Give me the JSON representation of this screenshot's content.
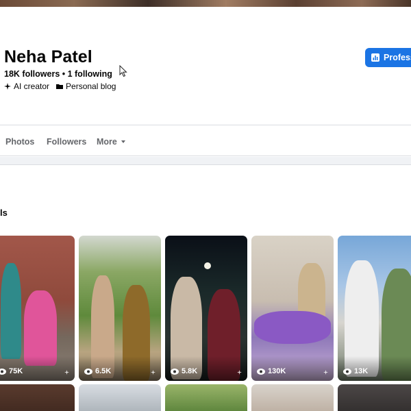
{
  "profile": {
    "name": "Neha Patel",
    "stats": "18K followers • 1 following",
    "tags": [
      "AI creator",
      "Personal blog"
    ],
    "pro_button_label": "Professional dashboard"
  },
  "tabs": {
    "photos": "Photos",
    "followers": "Followers",
    "more": "More"
  },
  "section": {
    "label": "ls"
  },
  "reels": [
    {
      "views": "75K"
    },
    {
      "views": "6.5K"
    },
    {
      "views": "5.8K"
    },
    {
      "views": "130K"
    },
    {
      "views": "13K"
    }
  ],
  "colors": {
    "accent": "#1b74e4",
    "muted_text": "#65676b",
    "divider": "#dadde1",
    "band": "#f0f2f5"
  },
  "icons": {
    "ai_creator": "sparkle-icon",
    "personal_blog": "folder-icon",
    "dashboard": "chart-icon",
    "views": "eye-icon",
    "more": "caret-down-icon"
  }
}
